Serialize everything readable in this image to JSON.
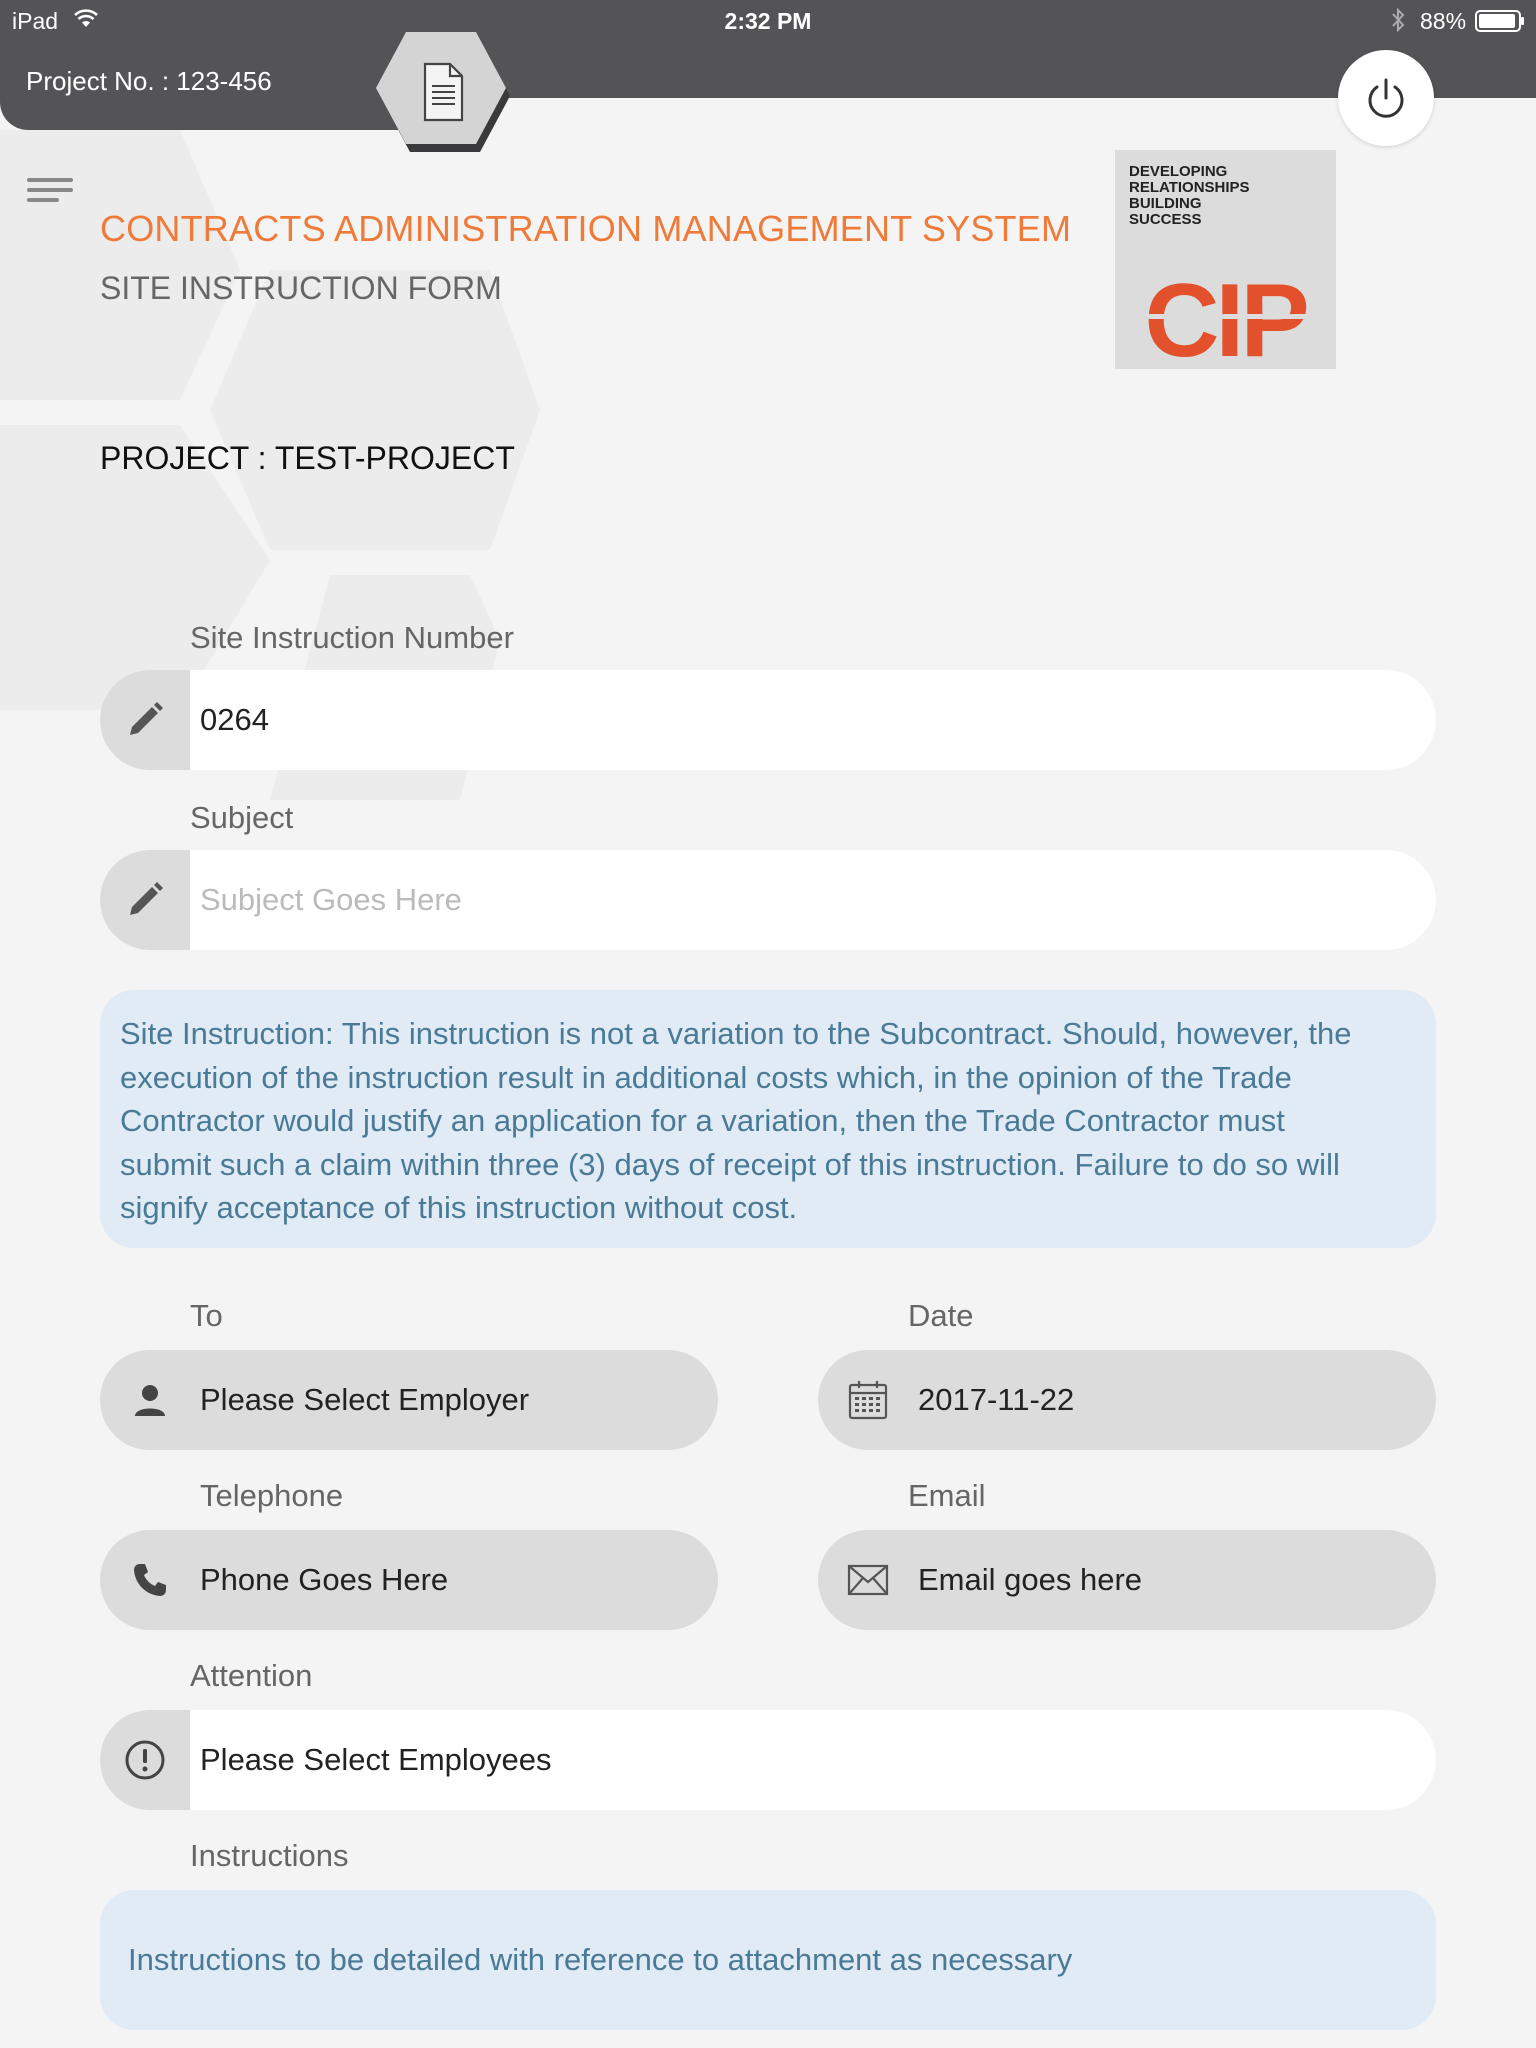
{
  "status_bar": {
    "device": "iPad",
    "time": "2:32 PM",
    "battery": "88%"
  },
  "header": {
    "project_no": "Project No. : 123-456",
    "app_title": "CONTRACTS ADMINISTRATION MANAGEMENT SYSTEM",
    "form_title": "SITE INSTRUCTION FORM",
    "logo": {
      "tagline": [
        "DEVELOPING",
        "RELATIONSHIPS",
        "BUILDING",
        "SUCCESS"
      ],
      "mark": "CIP"
    }
  },
  "project": "PROJECT : TEST-PROJECT",
  "form": {
    "si_number": {
      "label": "Site Instruction Number",
      "value": "0264"
    },
    "subject": {
      "label": "Subject",
      "placeholder": "Subject Goes Here"
    },
    "notice_lines": [
      "Site Instruction: This instruction is not a variation to the Subcontract. Should, however, the",
      "execution of the instruction result in additional costs which, in the opinion of the Trade",
      "Contractor would justify an application for a variation, then the Trade Contractor must",
      "submit such a claim within three (3) days of receipt of this instruction. Failure to do so will",
      "signify acceptance of this instruction without cost."
    ],
    "to": {
      "label": "To",
      "value": "Please Select Employer"
    },
    "date": {
      "label": "Date",
      "value": "2017-11-22"
    },
    "telephone": {
      "label": "Telephone",
      "value": "Phone Goes Here"
    },
    "email": {
      "label": "Email",
      "value": "Email goes here"
    },
    "attention": {
      "label": "Attention",
      "value": "Please Select Employees"
    },
    "instructions": {
      "label": "Instructions",
      "value": "Instructions to be detailed with reference to attachment as necessary"
    }
  },
  "colors": {
    "accent": "#ef7b3a",
    "topbar": "#545456",
    "logo_red": "#e2502c",
    "notice_bg": "#e0ebf5",
    "notice_text": "#4a7a95"
  },
  "icons": [
    "wifi-icon",
    "bluetooth-icon",
    "battery-icon",
    "document-icon",
    "power-icon",
    "menu-icon",
    "pencil-icon",
    "person-icon",
    "calendar-icon",
    "phone-icon",
    "mail-icon",
    "alert-icon"
  ]
}
